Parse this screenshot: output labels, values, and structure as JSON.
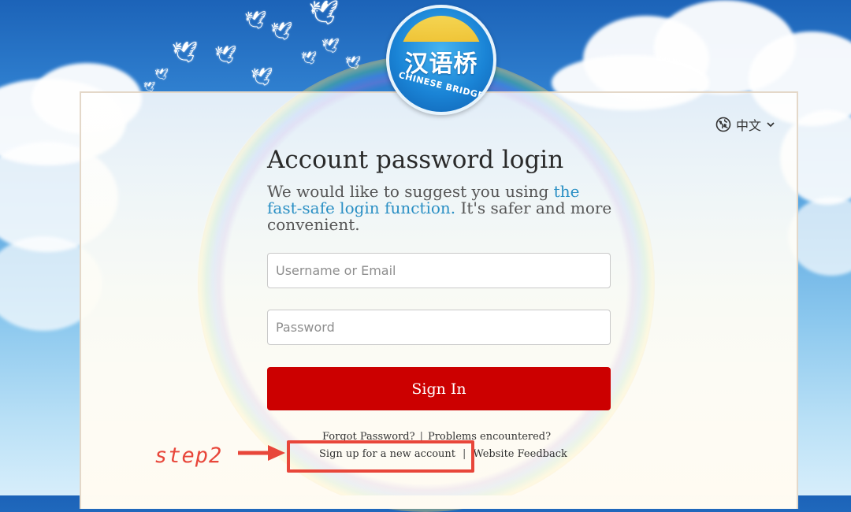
{
  "logo": {
    "chinese_text": "汉语桥",
    "english_text": "CHINESE BRIDGE"
  },
  "language_selector": {
    "label": "中文",
    "icon": "globe-icon",
    "chevron": "chevron-down-icon"
  },
  "login": {
    "title": "Account password login",
    "subtitle_prefix": "We would like to suggest you using ",
    "subtitle_link": "the fast-safe login function.",
    "subtitle_suffix": " It's safer and more convenient.",
    "username_placeholder": "Username or Email",
    "password_placeholder": "Password",
    "username_value": "",
    "password_value": "",
    "sign_in_label": "Sign In"
  },
  "footer_links": {
    "forgot_password": "Forgot Password?",
    "problems": "Problems encountered?",
    "sign_up": "Sign up for a new account",
    "feedback": "Website Feedback",
    "separator": "|"
  },
  "annotation": {
    "step_label": "step2",
    "color": "#e8463a"
  },
  "colors": {
    "primary_button": "#cc0000",
    "link": "#2a8fc4"
  }
}
